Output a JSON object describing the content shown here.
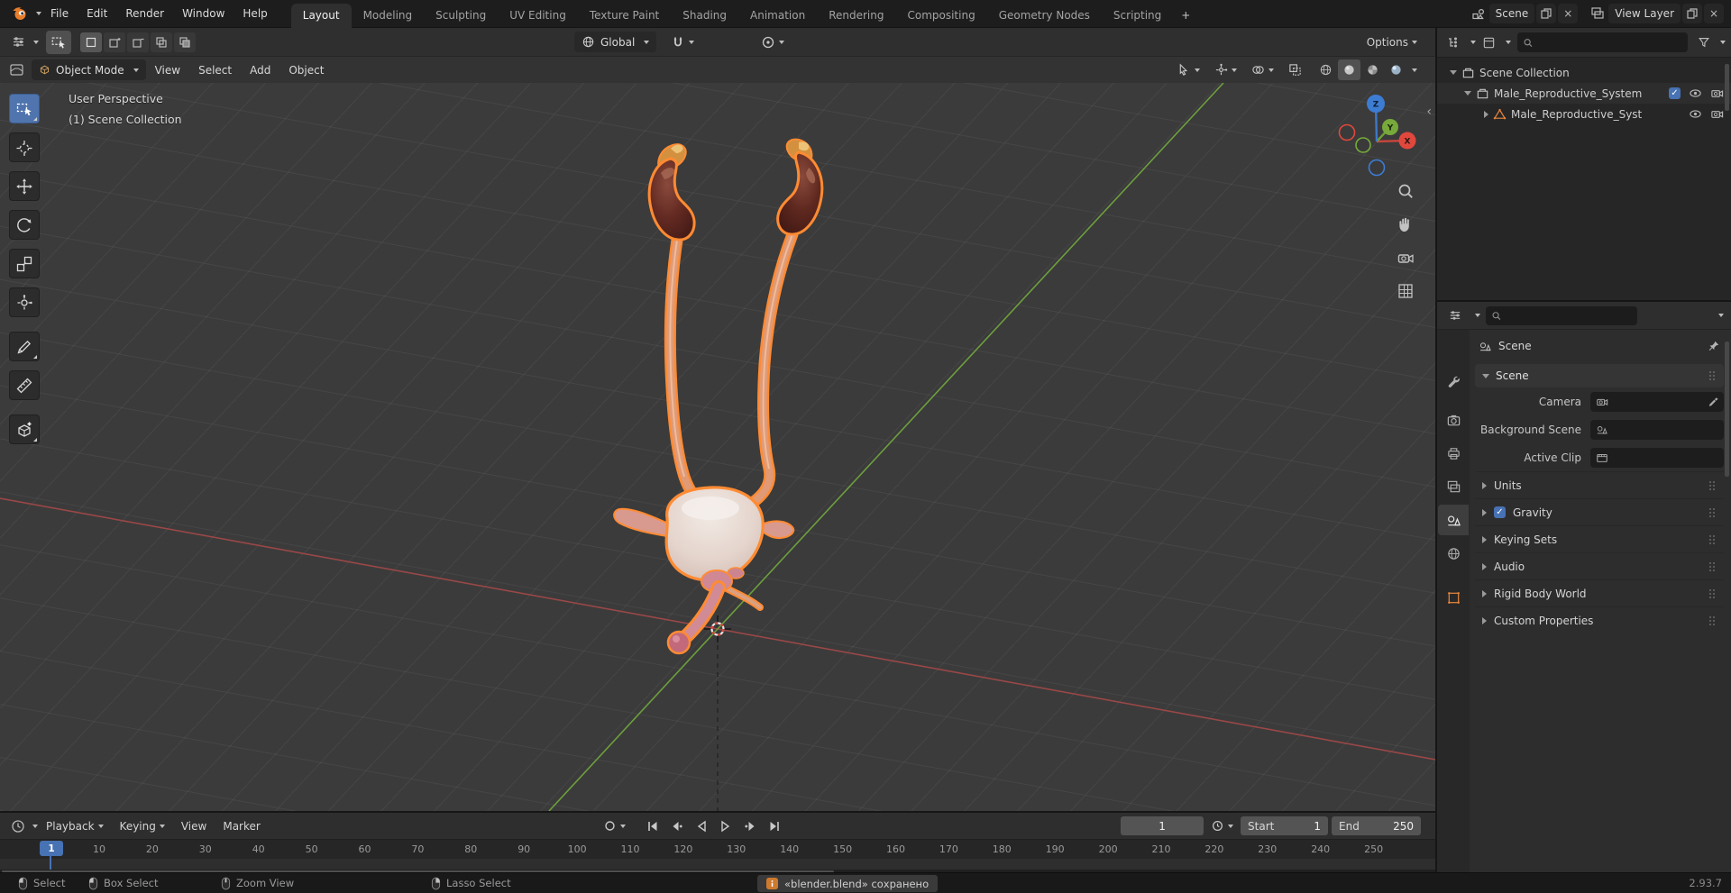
{
  "topbar": {
    "menus": [
      "File",
      "Edit",
      "Render",
      "Window",
      "Help"
    ],
    "workspace_tabs": [
      {
        "label": "Layout",
        "active": true
      },
      {
        "label": "Modeling"
      },
      {
        "label": "Sculpting"
      },
      {
        "label": "UV Editing"
      },
      {
        "label": "Texture Paint"
      },
      {
        "label": "Shading"
      },
      {
        "label": "Animation"
      },
      {
        "label": "Rendering"
      },
      {
        "label": "Compositing"
      },
      {
        "label": "Geometry Nodes"
      },
      {
        "label": "Scripting"
      }
    ],
    "add_workspace_label": "+",
    "scene_selector": {
      "value": "Scene"
    },
    "view_layer_selector": {
      "value": "View Layer"
    }
  },
  "tool_settings": {
    "orientation_value": "Global",
    "options_label": "Options"
  },
  "viewport_header": {
    "mode_value": "Object Mode",
    "menus": [
      "View",
      "Select",
      "Add",
      "Object"
    ]
  },
  "viewport": {
    "overlay_line1": "User Perspective",
    "overlay_line2": "(1) Scene Collection",
    "gizmo": {
      "x": "X",
      "y": "Y",
      "z": "Z"
    }
  },
  "outliner": {
    "search_placeholder": "",
    "rows": [
      {
        "label": "Scene Collection"
      },
      {
        "label": "Male_Reproductive_System"
      },
      {
        "label": "Male_Reproductive_Syst"
      }
    ]
  },
  "properties": {
    "search_placeholder": "",
    "tabs": [
      "tool",
      "render",
      "output",
      "view-layer",
      "scene",
      "world",
      "object"
    ],
    "active_tab": "scene",
    "breadcrumb": "Scene",
    "scene_panel": {
      "title": "Scene",
      "fields": [
        {
          "label": "Camera",
          "icon": "camera-icon",
          "eyedropper": true
        },
        {
          "label": "Background Scene",
          "icon": "scene-icon"
        },
        {
          "label": "Active Clip",
          "icon": "clip-icon"
        }
      ]
    },
    "sections_top": [
      "Units"
    ],
    "gravity": {
      "label": "Gravity",
      "checked": true
    },
    "sections_bottom": [
      "Keying Sets",
      "Audio",
      "Rigid Body World",
      "Custom Properties"
    ]
  },
  "timeline": {
    "menus": [
      {
        "label": "Playback",
        "caret": true
      },
      {
        "label": "Keying",
        "caret": true
      },
      {
        "label": "View"
      },
      {
        "label": "Marker"
      }
    ],
    "current_frame": "1",
    "playhead_label": "1",
    "start_label": "Start",
    "start_value": "1",
    "end_label": "End",
    "end_value": "250",
    "ruler": [
      "10",
      "20",
      "30",
      "40",
      "50",
      "60",
      "70",
      "80",
      "90",
      "100",
      "110",
      "120",
      "130",
      "140",
      "150",
      "160",
      "170",
      "180",
      "190",
      "200",
      "210",
      "220",
      "230",
      "240",
      "250"
    ]
  },
  "statusbar": {
    "hints": [
      {
        "label": "Select",
        "mouse": "left"
      },
      {
        "label": "Box Select",
        "mouse": "left-drag"
      },
      {
        "label": "Zoom View",
        "mouse": "middle"
      },
      {
        "label": "Lasso Select",
        "mouse": "right"
      }
    ],
    "message": "«blender.blend» сохранено",
    "version": "2.93.7"
  },
  "colors": {
    "accent": "#4772b3",
    "selection_outline": "#ff8b33",
    "axis_x": "#9a4747",
    "axis_y": "#6d9e3d",
    "gizmo_x": "#e0483d",
    "gizmo_y": "#77aa3a",
    "gizmo_z": "#3d7cd3"
  }
}
